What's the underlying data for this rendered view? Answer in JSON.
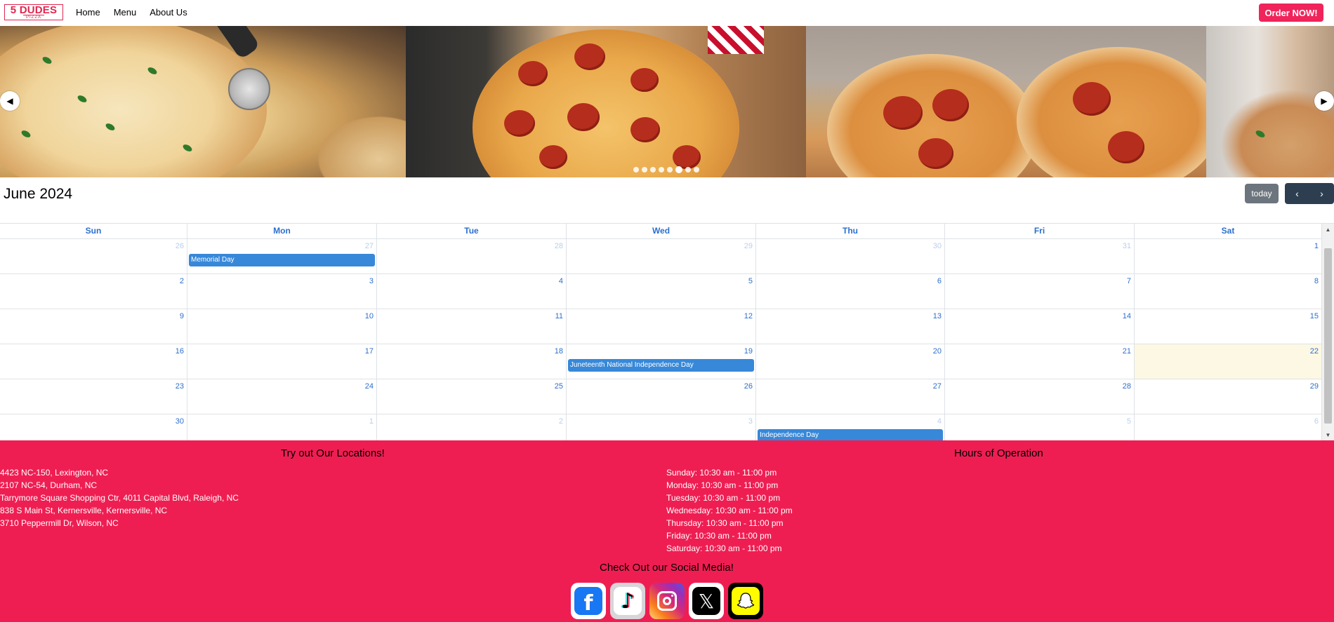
{
  "navbar": {
    "logo_main": "5 DUDES",
    "logo_sub": "PIZZA",
    "links": [
      "Home",
      "Menu",
      "About Us"
    ],
    "order_button": "Order NOW!"
  },
  "carousel": {
    "prev_icon": "chevron-left-icon",
    "next_icon": "chevron-right-icon",
    "dot_count": 8,
    "active_dot": 5
  },
  "calendar": {
    "title": "June 2024",
    "today_button": "today",
    "days_of_week": [
      "Sun",
      "Mon",
      "Tue",
      "Wed",
      "Thu",
      "Fri",
      "Sat"
    ],
    "weeks": [
      [
        {
          "n": "26",
          "other": true
        },
        {
          "n": "27",
          "other": true
        },
        {
          "n": "28",
          "other": true
        },
        {
          "n": "29",
          "other": true
        },
        {
          "n": "30",
          "other": true
        },
        {
          "n": "31",
          "other": true
        },
        {
          "n": "1",
          "other": false
        }
      ],
      [
        {
          "n": "2"
        },
        {
          "n": "3"
        },
        {
          "n": "4"
        },
        {
          "n": "5"
        },
        {
          "n": "6"
        },
        {
          "n": "7"
        },
        {
          "n": "8"
        }
      ],
      [
        {
          "n": "9"
        },
        {
          "n": "10"
        },
        {
          "n": "11"
        },
        {
          "n": "12"
        },
        {
          "n": "13"
        },
        {
          "n": "14"
        },
        {
          "n": "15"
        }
      ],
      [
        {
          "n": "16"
        },
        {
          "n": "17"
        },
        {
          "n": "18"
        },
        {
          "n": "19"
        },
        {
          "n": "20"
        },
        {
          "n": "21"
        },
        {
          "n": "22",
          "today": true
        }
      ],
      [
        {
          "n": "23"
        },
        {
          "n": "24"
        },
        {
          "n": "25"
        },
        {
          "n": "26"
        },
        {
          "n": "27"
        },
        {
          "n": "28"
        },
        {
          "n": "29"
        }
      ],
      [
        {
          "n": "30"
        },
        {
          "n": "1",
          "other": true
        },
        {
          "n": "2",
          "other": true
        },
        {
          "n": "3",
          "other": true
        },
        {
          "n": "4",
          "other": true
        },
        {
          "n": "5",
          "other": true
        },
        {
          "n": "6",
          "other": true
        }
      ]
    ],
    "events": [
      {
        "title": "Memorial Day",
        "week": 0,
        "day": 1
      },
      {
        "title": "Juneteenth National Independence Day",
        "week": 3,
        "day": 3
      },
      {
        "title": "Independence Day",
        "week": 5,
        "day": 4
      }
    ],
    "event_color": "#3788d8",
    "today_highlight": "#fdf8e3"
  },
  "footer": {
    "locations_heading": "Try out Our Locations!",
    "locations": [
      "4423 NC-150, Lexington, NC",
      "2107 NC-54, Durham, NC",
      "Tarrymore Square Shopping Ctr, 4011 Capital Blvd, Raleigh, NC",
      "838 S Main St, Kernersville, Kernersville, NC",
      "3710 Peppermill Dr, Wilson, NC"
    ],
    "hours_heading": "Hours of Operation",
    "hours": [
      "Sunday: 10:30 am - 11:00 pm",
      "Monday: 10:30 am - 11:00 pm",
      "Tuesday: 10:30 am - 11:00 pm",
      "Wednesday: 10:30 am - 11:00 pm",
      "Thursday: 10:30 am - 11:00 pm",
      "Friday: 10:30 am - 11:00 pm",
      "Saturday: 10:30 am - 11:00 pm"
    ],
    "social_heading": "Check Out our Social Media!",
    "socials": [
      "facebook-icon",
      "tiktok-icon",
      "instagram-icon",
      "x-twitter-icon",
      "snapchat-icon"
    ],
    "background": "#ef1e52"
  }
}
